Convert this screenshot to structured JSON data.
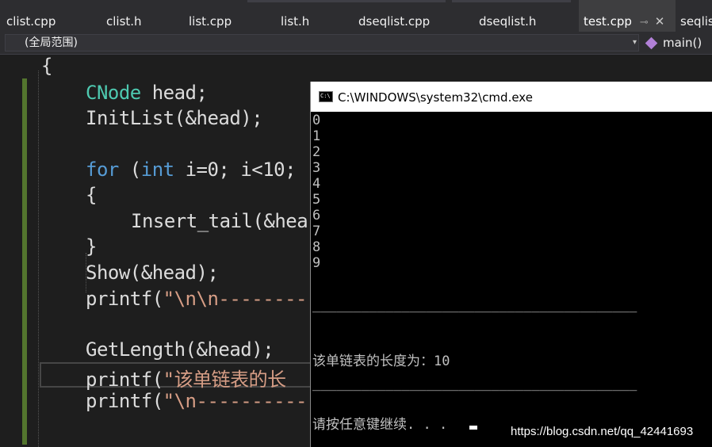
{
  "tabs": [
    {
      "label": "clist.cpp"
    },
    {
      "label": "clist.h"
    },
    {
      "label": "list.cpp"
    },
    {
      "label": "list.h"
    },
    {
      "label": "dseqlist.cpp"
    },
    {
      "label": "dseqlist.h"
    },
    {
      "label": "test.cpp",
      "active": true,
      "pin": "⊸",
      "close": "✕"
    },
    {
      "label": "seqlis"
    }
  ],
  "navbar": {
    "scope": "(全局范围)",
    "scope_dropdown": "▾",
    "member": "main()"
  },
  "code": {
    "brace_open": "{",
    "l1_type": "CNode",
    "l1_rest": " head;",
    "l2": "InitList(&head);",
    "l3_for": "for",
    "l3_a": " (",
    "l3_int": "int",
    "l3_b": " i=0; i<10;",
    "l4": "{",
    "l5": "Insert_tail(&hea",
    "l6": "}",
    "l7": "Show(&head);",
    "l8_a": "printf(",
    "l8_s": "\"\\n\\n---------",
    "l9": "GetLength(&head);",
    "l10_a": "printf(",
    "l10_s": "\"该单链表的长",
    "l11_a": "printf(",
    "l11_s": "\"\\n----------"
  },
  "console": {
    "title": "C:\\WINDOWS\\system32\\cmd.exe",
    "icon_text": "C:\\",
    "numbers": [
      "0",
      "1",
      "2",
      "3",
      "4",
      "5",
      "6",
      "7",
      "8",
      "9"
    ],
    "separator": "________________________________________",
    "length_line": "该单链表的长度为：10",
    "prompt": "请按任意键继续. . ."
  },
  "watermark": "https://blog.csdn.net/qq_42441693"
}
